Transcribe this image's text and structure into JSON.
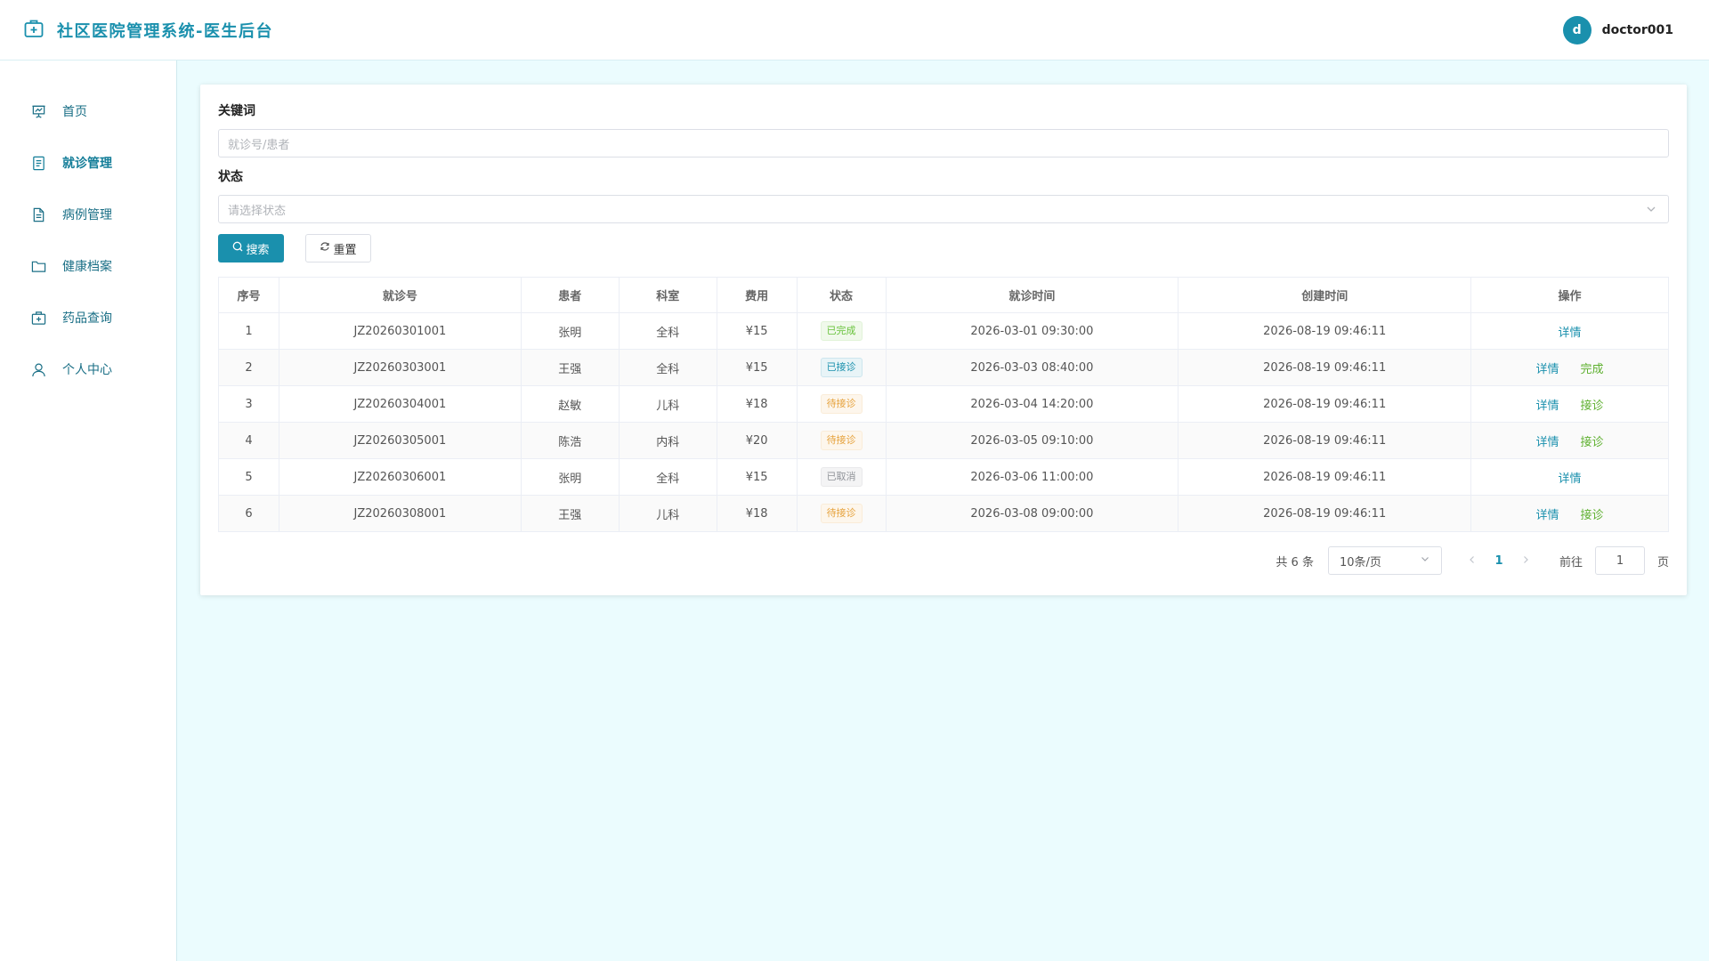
{
  "header": {
    "title": "社区医院管理系统-医生后台",
    "avatar_letter": "d",
    "username": "doctor001"
  },
  "sidebar": {
    "items": [
      {
        "label": "首页",
        "icon": "chart-board-icon"
      },
      {
        "label": "就诊管理",
        "icon": "document-icon",
        "active": true
      },
      {
        "label": "病例管理",
        "icon": "file-text-icon"
      },
      {
        "label": "健康档案",
        "icon": "folder-icon"
      },
      {
        "label": "药品查询",
        "icon": "medicine-box-icon"
      },
      {
        "label": "个人中心",
        "icon": "user-icon"
      }
    ]
  },
  "filters": {
    "keyword_label": "关键词",
    "keyword_placeholder": "就诊号/患者",
    "status_label": "状态",
    "status_placeholder": "请选择状态",
    "search_label": "搜索",
    "reset_label": "重置"
  },
  "table": {
    "headers": [
      "序号",
      "就诊号",
      "患者",
      "科室",
      "费用",
      "状态",
      "就诊时间",
      "创建时间",
      "操作"
    ],
    "rows": [
      {
        "no": "1",
        "code": "JZ20260301001",
        "patient": "张明",
        "dept": "全科",
        "fee": "¥15",
        "status": "已完成",
        "status_type": "success",
        "visit_time": "2026-03-01 09:30:00",
        "created": "2026-08-19 09:46:11",
        "actions": [
          "详情"
        ]
      },
      {
        "no": "2",
        "code": "JZ20260303001",
        "patient": "王强",
        "dept": "全科",
        "fee": "¥15",
        "status": "已接诊",
        "status_type": "primary",
        "visit_time": "2026-03-03 08:40:00",
        "created": "2026-08-19 09:46:11",
        "actions": [
          "详情",
          "完成"
        ]
      },
      {
        "no": "3",
        "code": "JZ20260304001",
        "patient": "赵敏",
        "dept": "儿科",
        "fee": "¥18",
        "status": "待接诊",
        "status_type": "warning",
        "visit_time": "2026-03-04 14:20:00",
        "created": "2026-08-19 09:46:11",
        "actions": [
          "详情",
          "接诊"
        ]
      },
      {
        "no": "4",
        "code": "JZ20260305001",
        "patient": "陈浩",
        "dept": "内科",
        "fee": "¥20",
        "status": "待接诊",
        "status_type": "warning",
        "visit_time": "2026-03-05 09:10:00",
        "created": "2026-08-19 09:46:11",
        "actions": [
          "详情",
          "接诊"
        ]
      },
      {
        "no": "5",
        "code": "JZ20260306001",
        "patient": "张明",
        "dept": "全科",
        "fee": "¥15",
        "status": "已取消",
        "status_type": "info",
        "visit_time": "2026-03-06 11:00:00",
        "created": "2026-08-19 09:46:11",
        "actions": [
          "详情"
        ]
      },
      {
        "no": "6",
        "code": "JZ20260308001",
        "patient": "王强",
        "dept": "儿科",
        "fee": "¥18",
        "status": "待接诊",
        "status_type": "warning",
        "visit_time": "2026-03-08 09:00:00",
        "created": "2026-08-19 09:46:11",
        "actions": [
          "详情",
          "接诊"
        ]
      }
    ]
  },
  "pagination": {
    "total_text": "共 6 条",
    "page_size": "10条/页",
    "current_page": "1",
    "goto_label": "前往",
    "goto_value": "1",
    "page_suffix": "页"
  },
  "colors": {
    "accent": "#1a90ad",
    "background": "#ebfcfe"
  }
}
